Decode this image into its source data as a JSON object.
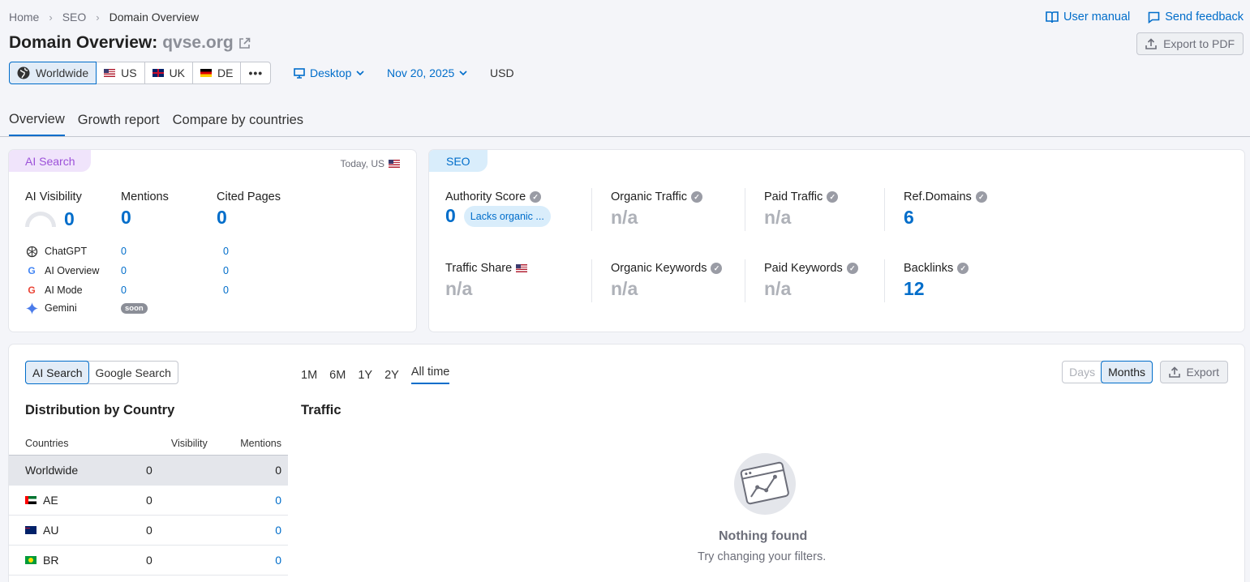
{
  "breadcrumb": {
    "home": "Home",
    "seo": "SEO",
    "current": "Domain Overview"
  },
  "top_links": {
    "manual": "User manual",
    "feedback": "Send feedback"
  },
  "header": {
    "title": "Domain Overview:",
    "domain": "qvse.org",
    "export_pdf": "Export to PDF"
  },
  "db_selector": {
    "worldwide": "Worldwide",
    "us": "US",
    "uk": "UK",
    "de": "DE"
  },
  "device": "Desktop",
  "date": "Nov 20, 2025",
  "currency": "USD",
  "tabs": [
    "Overview",
    "Growth report",
    "Compare by countries"
  ],
  "ai_card": {
    "chip": "AI Search",
    "today": "Today, US",
    "visibility_label": "AI Visibility",
    "visibility_value": "0",
    "mentions_label": "Mentions",
    "mentions_value": "0",
    "cited_label": "Cited Pages",
    "cited_value": "0",
    "rows": [
      {
        "name": "ChatGPT",
        "mentions": "0",
        "cited": "0"
      },
      {
        "name": "AI Overview",
        "mentions": "0",
        "cited": "0"
      },
      {
        "name": "AI Mode",
        "mentions": "0",
        "cited": "0"
      },
      {
        "name": "Gemini",
        "soon": "soon"
      }
    ]
  },
  "seo_card": {
    "chip": "SEO",
    "authority_label": "Authority Score",
    "authority_value": "0",
    "authority_note": "Lacks organic ...",
    "organic_traffic_label": "Organic Traffic",
    "organic_traffic_value": "n/a",
    "paid_traffic_label": "Paid Traffic",
    "paid_traffic_value": "n/a",
    "ref_domains_label": "Ref.Domains",
    "ref_domains_value": "6",
    "traffic_share_label": "Traffic Share",
    "traffic_share_value": "n/a",
    "organic_keywords_label": "Organic Keywords",
    "organic_keywords_value": "n/a",
    "paid_keywords_label": "Paid Keywords",
    "paid_keywords_value": "n/a",
    "backlinks_label": "Backlinks",
    "backlinks_value": "12"
  },
  "bottom": {
    "source_toggle": [
      "AI Search",
      "Google Search"
    ],
    "periods": [
      "1M",
      "6M",
      "1Y",
      "2Y",
      "All time"
    ],
    "granularity": [
      "Days",
      "Months"
    ],
    "export": "Export",
    "distribution_title": "Distribution by Country",
    "traffic_title": "Traffic",
    "table_headers": [
      "Countries",
      "Visibility",
      "Mentions"
    ],
    "countries": [
      {
        "name": "Worldwide",
        "visibility": "0",
        "mentions": "0"
      },
      {
        "name": "AE",
        "visibility": "0",
        "mentions": "0"
      },
      {
        "name": "AU",
        "visibility": "0",
        "mentions": "0"
      },
      {
        "name": "BR",
        "visibility": "0",
        "mentions": "0"
      }
    ],
    "empty_title": "Nothing found",
    "empty_sub": "Try changing your filters."
  },
  "colors": {
    "accent": "#006dca",
    "ai_chip_bg": "#f0e4fb",
    "seo_chip_bg": "#d9edfb",
    "na_gray": "#aeb1b8"
  }
}
